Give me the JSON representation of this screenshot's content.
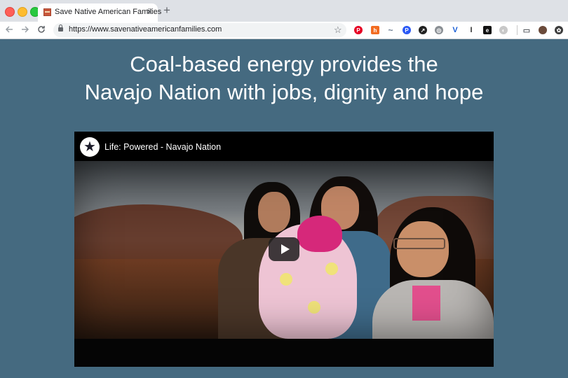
{
  "browser": {
    "tab": {
      "title": "Save Native American Families"
    },
    "address_bar": {
      "url": "https://www.savenativeamericanfamilies.com"
    },
    "extensions": [
      {
        "name": "pinterest-icon",
        "color": "#e60023",
        "glyph": "P"
      },
      {
        "name": "honey-icon",
        "color": "#f26c22",
        "glyph": "h"
      },
      {
        "name": "momentum-icon",
        "color": "#6b7a8f",
        "glyph": "~"
      },
      {
        "name": "pocket-icon",
        "color": "#2b59f5",
        "glyph": "P"
      },
      {
        "name": "stylus-icon",
        "color": "#222222",
        "glyph": "↗"
      },
      {
        "name": "generic-extension-icon",
        "color": "#8a8f94",
        "glyph": "◎"
      },
      {
        "name": "vuejs-devtools-icon",
        "color": "#1b5fd6",
        "glyph": "V"
      },
      {
        "name": "instapaper-icon",
        "color": "#333333",
        "glyph": "I"
      },
      {
        "name": "evernote-icon",
        "color": "#111111",
        "glyph": "e"
      },
      {
        "name": "toggle-extension-icon",
        "color": "#c8c8c8",
        "glyph": "◐"
      },
      {
        "name": "cast-icon",
        "color": "#5f6368",
        "glyph": "▭"
      },
      {
        "name": "profile-avatar-icon",
        "color": "#6a4a3a",
        "glyph": "●"
      },
      {
        "name": "menu-extension-icon",
        "color": "#3c3c3c",
        "glyph": "✿"
      }
    ]
  },
  "page": {
    "headline_line1": "Coal-based energy provides the",
    "headline_line2": "Navajo Nation with jobs, dignity and hope",
    "video": {
      "title": "Life: Powered - Navajo Nation",
      "channel_logo": "star-logo-icon",
      "play_icon": "play-icon"
    }
  }
}
